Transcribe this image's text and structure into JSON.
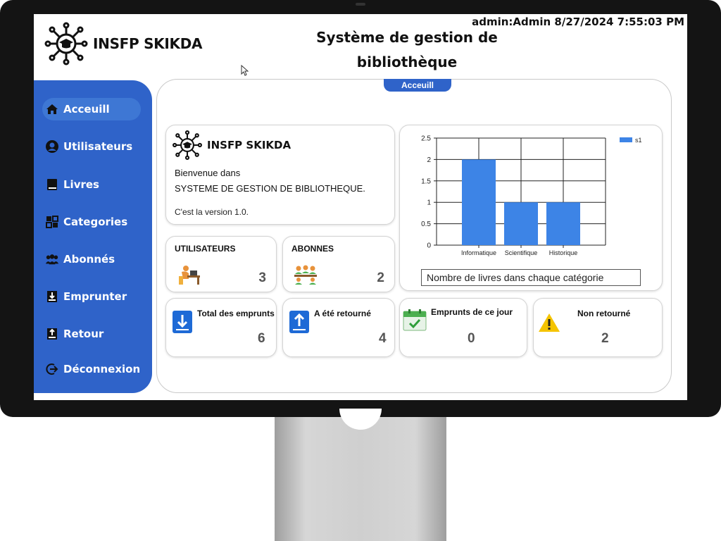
{
  "header": {
    "logo_text": "INSFP SKIKDA",
    "title_line1": "Système de gestion de",
    "title_line2": "bibliothèque",
    "session": "admin:Admin  8/27/2024 7:55:03 PM"
  },
  "sidebar": {
    "items": [
      {
        "label": "Acceuill",
        "icon": "home-icon",
        "active": true
      },
      {
        "label": "Utilisateurs",
        "icon": "user-icon"
      },
      {
        "label": "Livres",
        "icon": "book-icon"
      },
      {
        "label": "Categories",
        "icon": "grid-icon"
      },
      {
        "label": "Abonnés",
        "icon": "group-icon"
      },
      {
        "label": "Emprunter",
        "icon": "borrow-icon"
      },
      {
        "label": "Retour",
        "icon": "return-icon"
      },
      {
        "label": "Déconnexion",
        "icon": "logout-icon"
      }
    ]
  },
  "main": {
    "tab": "Acceuill",
    "welcome": {
      "logo_text": "INSFP SKIKDA",
      "line1": "Bienvenue dans",
      "line2": "SYSTEME DE GESTION DE BIBLIOTHEQUE.",
      "version": "C'est la version 1.0."
    },
    "stats": {
      "utilisateurs": {
        "label": "UTILISATEURS",
        "value": "3"
      },
      "abonnes": {
        "label": "ABONNES",
        "value": "2"
      }
    },
    "bottom": {
      "total": {
        "label": "Total des emprunts",
        "value": "6"
      },
      "retourne": {
        "label": "A été retourné",
        "value": "4"
      },
      "jour": {
        "label": "Emprunts de ce jour",
        "value": "0"
      },
      "non_retourne": {
        "label": "Non retourné",
        "value": "2"
      }
    },
    "chart_caption": "Nombre de livres dans chaque catégorie"
  },
  "colors": {
    "sidebar": "#2f63c9",
    "bar": "#3d84e6",
    "warning": "#f5c400"
  },
  "chart_data": {
    "type": "bar",
    "categories": [
      "Informatique",
      "Scientifique",
      "Historique"
    ],
    "series": [
      {
        "name": "s1",
        "values": [
          2,
          1,
          1
        ]
      }
    ],
    "ylim": [
      0,
      2.5
    ],
    "yticks": [
      "0",
      "0.5",
      "1",
      "1.5",
      "2",
      "2.5"
    ],
    "grid": true,
    "legend": "top-right"
  }
}
